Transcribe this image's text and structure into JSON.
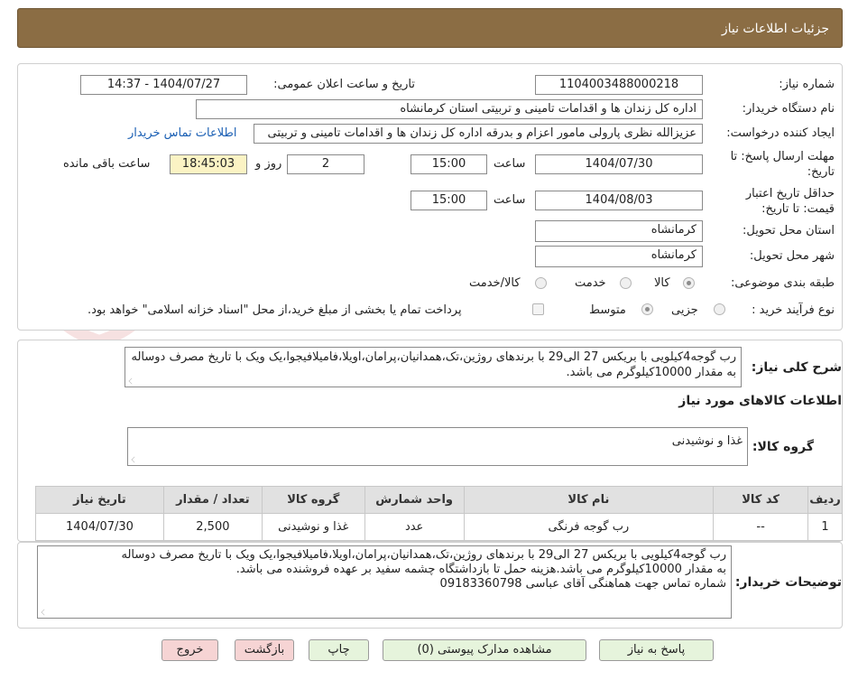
{
  "header": {
    "title": "جزئیات اطلاعات نیاز"
  },
  "watermark_text": "AriaTender.net",
  "form": {
    "need_number_label": "شماره نیاز:",
    "need_number": "1104003488000218",
    "announce_label": "تاریخ و ساعت اعلان عمومی:",
    "announce_value": "1404/07/27 - 14:37",
    "buyer_label": "نام دستگاه خریدار:",
    "buyer_value": "اداره کل زندان ها و اقدامات تامینی و تربیتی استان کرمانشاه",
    "creator_label": "ایجاد کننده درخواست:",
    "creator_value": "عزیزالله نظری پارولی مامور اعزام و بدرقه اداره کل زندان ها و اقدامات تامینی و تربیتی",
    "contact_link": "اطلاعات تماس خریدار",
    "deadline_label_1": "مهلت ارسال پاسخ: تا",
    "deadline_label_2": "تاریخ:",
    "deadline_date": "1404/07/30",
    "time_label": "ساعت",
    "deadline_time": "15:00",
    "days_value": "2",
    "days_label": "روز و",
    "remaining_time": "18:45:03",
    "remaining_label": "ساعت باقی مانده",
    "validity_label_1": "حداقل تاریخ اعتبار",
    "validity_label_2": "قیمت: تا تاریخ:",
    "validity_date": "1404/08/03",
    "validity_time": "15:00",
    "province_label": "استان محل تحویل:",
    "province_value": "کرمانشاه",
    "city_label": "شهر محل تحویل:",
    "city_value": "کرمانشاه",
    "category_label": "طبقه بندی موضوعی:",
    "category_options": [
      "کالا",
      "خدمت",
      "کالا/خدمت"
    ],
    "process_label": "نوع فرآیند خرید :",
    "process_options": [
      "جزیی",
      "متوسط"
    ],
    "treasury_note": "پرداخت تمام یا بخشی از مبلغ خرید،از محل \"اسناد خزانه اسلامی\" خواهد بود."
  },
  "summary": {
    "label": "شرح کلی نیاز:",
    "text": "رب گوجه4کیلویی با بریکس 27 الی29 با برندهای روژین،تک،همدانیان،پرامان،اویلا،فامیلافیجوا،یک ویک با تاریخ مصرف دوساله به مقدار 10000کیلوگرم می باشد.",
    "goods_info_title": "اطلاعات کالاهای مورد نیاز",
    "goods_group_label": "گروه کالا:",
    "goods_group_value": "غذا و نوشیدنی"
  },
  "table": {
    "headers": [
      "ردیف",
      "کد کالا",
      "نام کالا",
      "واحد شمارش",
      "گروه کالا",
      "تعداد / مقدار",
      "تاریخ نیاز"
    ],
    "rows": [
      [
        "1",
        "--",
        "رب گوجه فرنگی",
        "عدد",
        "غذا و نوشیدنی",
        "2,500",
        "1404/07/30"
      ]
    ]
  },
  "buyer_notes": {
    "label": "توضیحات خریدار:",
    "lines": [
      "رب گوجه4کیلویی با بریکس 27 الی29 با برندهای روژین،تک،همدانیان،پرامان،اویلا،فامیلافیجوا،یک ویک با تاریخ مصرف دوساله",
      "به مقدار 10000کیلوگرم می باشد.هزینه حمل تا بازداشتگاه چشمه سفید بر عهده فروشنده می باشد.",
      "شماره تماس جهت هماهنگی آقای عباسی 09183360798"
    ]
  },
  "buttons": {
    "reply": "پاسخ به نیاز",
    "attachments": "مشاهده مدارک پیوستی (0)",
    "print": "چاپ",
    "back": "بازگشت",
    "exit": "خروج"
  }
}
